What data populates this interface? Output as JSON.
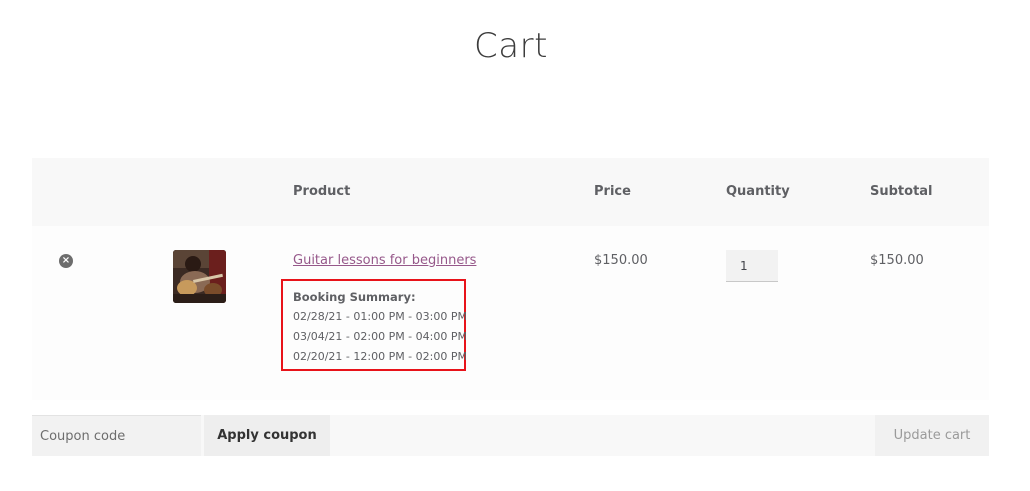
{
  "page": {
    "title": "Cart"
  },
  "cart_table": {
    "headers": {
      "product": "Product",
      "price": "Price",
      "quantity": "Quantity",
      "subtotal": "Subtotal"
    },
    "items": [
      {
        "remove_icon": "close-circle-icon",
        "thumbnail": "guitar-lesson-thumbnail",
        "name": "Guitar lessons for beginners",
        "booking_summary": {
          "title": "Booking Summary:",
          "slots": [
            "02/28/21 - 01:00 PM - 03:00 PM",
            "03/04/21 - 02:00 PM - 04:00 PM",
            "02/20/21 - 12:00 PM - 02:00 PM"
          ]
        },
        "price": "$150.00",
        "quantity": "1",
        "subtotal": "$150.00"
      }
    ]
  },
  "actions": {
    "coupon_placeholder": "Coupon code",
    "apply_coupon_label": "Apply coupon",
    "update_cart_label": "Update cart"
  },
  "colors": {
    "link": "#96588a",
    "highlight_border": "#e8131a"
  }
}
